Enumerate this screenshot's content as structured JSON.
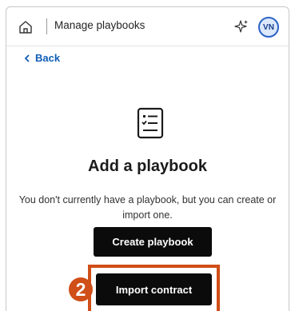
{
  "header": {
    "title": "Manage playbooks",
    "avatar_initials": "VN",
    "icons": [
      "home-icon",
      "sparkle-icon"
    ]
  },
  "nav": {
    "back_label": "Back"
  },
  "empty_state": {
    "icon": "playbook-checklist-icon",
    "heading": "Add a playbook",
    "description": "You don't currently have a playbook, but you can create or import one.",
    "create_label": "Create playbook",
    "import_label": "Import contract"
  },
  "annotation": {
    "step_number": "2",
    "color": "#d04e18"
  },
  "colors": {
    "accent": "#0f5db5",
    "button": "#0b0b0b",
    "avatar_border": "#2b63c6"
  }
}
